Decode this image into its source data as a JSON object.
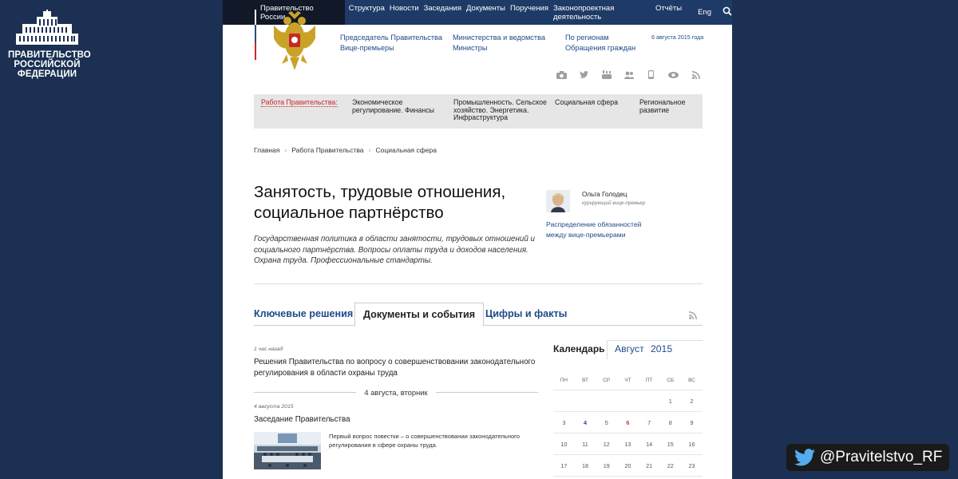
{
  "logo": {
    "lines": [
      "ПРАВИТЕЛЬСТВО",
      "РОССИЙСКОЙ",
      "ФЕДЕРАЦИИ"
    ]
  },
  "topnav": {
    "home": "Правительство России",
    "items": [
      "Структура",
      "Новости",
      "Заседания",
      "Документы",
      "Поручения",
      "Законопроектная деятельность",
      "Отчёты"
    ],
    "lang": "Eng"
  },
  "header": {
    "col1": [
      "Председатель Правительства",
      "Вице-премьеры"
    ],
    "col2": [
      "Министерства и ведомства",
      "Министры"
    ],
    "col3": [
      "По регионам",
      "Обращения граждан"
    ],
    "date": "6 августа 2015 года",
    "socials": [
      "camera-icon",
      "twitter-icon",
      "youtube-icon",
      "community-icon",
      "mobile-icon",
      "eye-icon",
      "rss-icon"
    ]
  },
  "workbar": {
    "label": "Работа Правительства:",
    "items": [
      "Экономическое регулирование. Финансы",
      "Промышленность. Сельское хозяйство. Энергетика. Инфраструктура",
      "Социальная сфера",
      "Региональное развитие"
    ]
  },
  "breadcrumbs": [
    "Главная",
    "Работа Правительства",
    "Социальная сфера"
  ],
  "page": {
    "title_line1": "Занятость, трудовые отношения,",
    "title_line2": "социальное партнёрство",
    "description": "Государственная политика в области занятости, трудовых отношений и социального партнёрства. Вопросы оплаты труда и доходов населения. Охрана труда. Профессиональные стандарты."
  },
  "curator": {
    "name": "Ольга Голодец",
    "role": "курирующий вице-премьер",
    "link_line1": "Распределение обязанностей",
    "link_line2": "между вице-премьерами"
  },
  "tabs": [
    "Ключевые решения",
    "Документы и события",
    "Цифры и факты"
  ],
  "news": [
    {
      "time": "1 час назад",
      "title": "Решения Правительства по вопросу о совершенствовании законодательного регулирования в области охраны труда"
    },
    {
      "time": "4 августа 2015",
      "title": "Заседание Правительства",
      "description": "Первый вопрос повестки – о совершенствовании законодательного регулирования в сфере охраны труда."
    }
  ],
  "date_separator": "4 августа, вторник",
  "calendar": {
    "label": "Календарь",
    "month": "Август",
    "year": "2015",
    "dow": [
      "ПН",
      "ВТ",
      "СР",
      "ЧТ",
      "ПТ",
      "СБ",
      "ВС"
    ],
    "weeks": [
      [
        "",
        "",
        "",
        "",
        "",
        "1",
        "2"
      ],
      [
        "3",
        "4",
        "5",
        "6",
        "7",
        "8",
        "9"
      ],
      [
        "10",
        "11",
        "12",
        "13",
        "14",
        "15",
        "16"
      ],
      [
        "17",
        "18",
        "19",
        "20",
        "21",
        "22",
        "23"
      ]
    ],
    "linked_days": [
      "4"
    ],
    "highlight_day": "6"
  },
  "twitter": {
    "handle": "@Pravitelstvo_RF"
  },
  "colors": {
    "background": "#1b3052",
    "nav": "#1e3a66",
    "link": "#1f4a8a",
    "accent_red": "#c62828"
  }
}
